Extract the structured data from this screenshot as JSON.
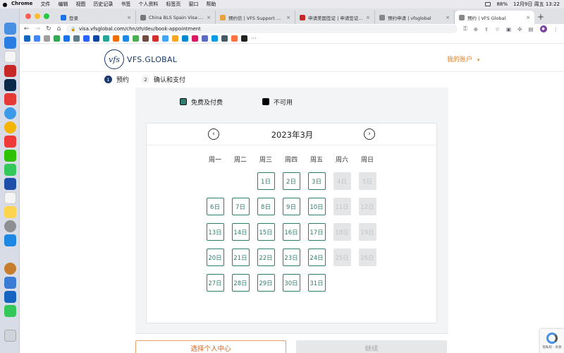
{
  "menubar": {
    "items": [
      "Chrome",
      "文件",
      "编辑",
      "视图",
      "历史记录",
      "书签",
      "个人资料",
      "标签页",
      "窗口",
      "帮助"
    ],
    "battery": "88%",
    "clock": "12月9日 周五 13:22"
  },
  "tabs": [
    {
      "title": "登录",
      "favicon_color": "#1a73e8",
      "active": false
    },
    {
      "title": "China BLS Spain Visa: For any",
      "favicon_color": "#777777",
      "active": false
    },
    {
      "title": "预约信 | VFS Support Query Li",
      "favicon_color": "#e8a33d",
      "active": false
    },
    {
      "title": "申请美国签证 | 申请签证 - 在中",
      "favicon_color": "#c62828",
      "active": false
    },
    {
      "title": "预约申请 | vfsglobal",
      "favicon_color": "#888888",
      "active": false
    },
    {
      "title": "预约 | VFS Global",
      "favicon_color": "#888888",
      "active": true
    }
  ],
  "address": {
    "url": "visa.vfsglobal.com/chn/zh/deu/book-appointment"
  },
  "header": {
    "logo_mark": "vfs",
    "logo_text": "VFS.GLOBAL",
    "account_label": "我的账户",
    "account_chevron": "▾"
  },
  "steps": [
    {
      "num": "1",
      "label": "预约",
      "state": "done"
    },
    {
      "num": "2",
      "label": "确认和支付",
      "state": "pending"
    }
  ],
  "legend": [
    {
      "label": "免费及付费",
      "color": "#2f7d6d"
    },
    {
      "label": "不可用",
      "color": "#000000"
    }
  ],
  "calendar": {
    "month_label": "2023年3月",
    "prev_icon": "‹",
    "next_icon": "›",
    "weekdays": [
      "周一",
      "周二",
      "周三",
      "周四",
      "周五",
      "周六",
      "周日"
    ],
    "days": [
      {
        "label": "1日",
        "available": true
      },
      {
        "label": "2日",
        "available": true
      },
      {
        "label": "3日",
        "available": true
      },
      {
        "label": "4日",
        "available": false
      },
      {
        "label": "5日",
        "available": false
      },
      {
        "label": "6日",
        "available": true
      },
      {
        "label": "7日",
        "available": true
      },
      {
        "label": "8日",
        "available": true
      },
      {
        "label": "9日",
        "available": true
      },
      {
        "label": "10日",
        "available": true
      },
      {
        "label": "11日",
        "available": false
      },
      {
        "label": "12日",
        "available": false
      },
      {
        "label": "13日",
        "available": true
      },
      {
        "label": "14日",
        "available": true
      },
      {
        "label": "15日",
        "available": true
      },
      {
        "label": "16日",
        "available": true
      },
      {
        "label": "17日",
        "available": true
      },
      {
        "label": "18日",
        "available": false
      },
      {
        "label": "19日",
        "available": false
      },
      {
        "label": "20日",
        "available": true
      },
      {
        "label": "21日",
        "available": true
      },
      {
        "label": "22日",
        "available": true
      },
      {
        "label": "23日",
        "available": true
      },
      {
        "label": "24日",
        "available": true
      },
      {
        "label": "25日",
        "available": false
      },
      {
        "label": "26日",
        "available": false
      },
      {
        "label": "27日",
        "available": true
      },
      {
        "label": "28日",
        "available": true
      },
      {
        "label": "29日",
        "available": true
      },
      {
        "label": "30日",
        "available": true
      },
      {
        "label": "31日",
        "available": true
      }
    ]
  },
  "buttons": {
    "select_label": "选择个人中心",
    "continue_label": "继续"
  },
  "recaptcha": {
    "text": "隐私权 - 条款"
  },
  "colors": {
    "accent": "#2f7d6d",
    "brand": "#1a3a6b",
    "account": "#d5822a",
    "unavailable_bg": "#e4e5e7"
  }
}
